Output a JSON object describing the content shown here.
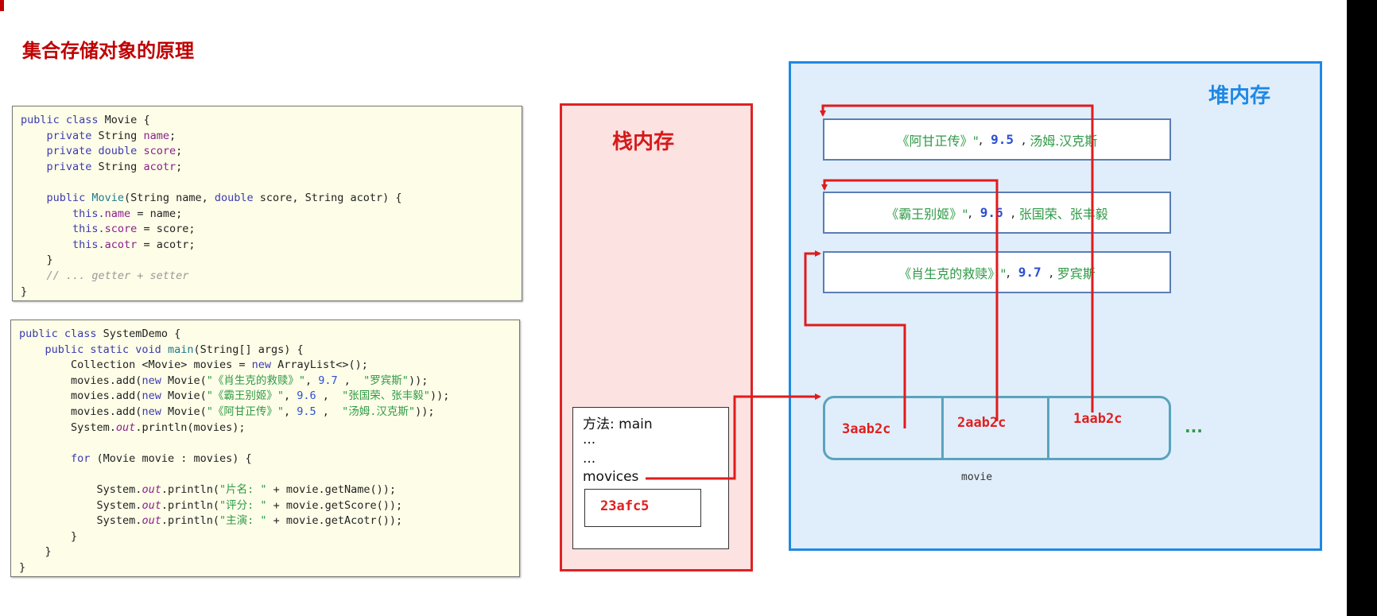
{
  "title": "集合存储对象的原理",
  "code_movie": [
    [
      [
        "public class ",
        "kw"
      ],
      [
        "Movie {",
        ""
      ]
    ],
    [
      [
        "    private ",
        "kw"
      ],
      [
        "String ",
        ""
      ],
      [
        "name",
        "fld"
      ],
      [
        ";",
        ""
      ]
    ],
    [
      [
        "    private double ",
        "kw"
      ],
      [
        "score",
        "fld"
      ],
      [
        ";",
        ""
      ]
    ],
    [
      [
        "    private ",
        "kw"
      ],
      [
        "String ",
        ""
      ],
      [
        "acotr",
        "fld"
      ],
      [
        ";",
        ""
      ]
    ],
    [
      [
        "",
        ""
      ]
    ],
    [
      [
        "    public ",
        "kw"
      ],
      [
        "Movie",
        "fn"
      ],
      [
        "(String name, ",
        ""
      ],
      [
        "double ",
        "kw"
      ],
      [
        "score, String acotr) {",
        ""
      ]
    ],
    [
      [
        "        this.",
        "kw"
      ],
      [
        "name",
        "fld"
      ],
      [
        " = name;",
        ""
      ]
    ],
    [
      [
        "        this.",
        "kw"
      ],
      [
        "score",
        "fld"
      ],
      [
        " = score;",
        ""
      ]
    ],
    [
      [
        "        this.",
        "kw"
      ],
      [
        "acotr",
        "fld"
      ],
      [
        " = acotr;",
        ""
      ]
    ],
    [
      [
        "    }",
        ""
      ]
    ],
    [
      [
        "    // ... getter + setter",
        "cm"
      ]
    ],
    [
      [
        "}",
        ""
      ]
    ]
  ],
  "code_demo": [
    [
      [
        "public class ",
        "kw"
      ],
      [
        "SystemDemo {",
        ""
      ]
    ],
    [
      [
        "    public static void ",
        "kw"
      ],
      [
        "main",
        "fn"
      ],
      [
        "(String[] args) {",
        ""
      ]
    ],
    [
      [
        "        Collection <Movie> movies = ",
        ""
      ],
      [
        "new ",
        "kw"
      ],
      [
        "ArrayList<>();",
        ""
      ]
    ],
    [
      [
        "        movies.add(",
        ""
      ],
      [
        "new ",
        "kw"
      ],
      [
        "Movie(",
        ""
      ],
      [
        "\"《肖生克的救赎》\"",
        "str"
      ],
      [
        ", ",
        ""
      ],
      [
        "9.7",
        "num"
      ],
      [
        " ,  ",
        ""
      ],
      [
        "\"罗宾斯\"",
        "str"
      ],
      [
        "));",
        ""
      ]
    ],
    [
      [
        "        movies.add(",
        ""
      ],
      [
        "new ",
        "kw"
      ],
      [
        "Movie(",
        ""
      ],
      [
        "\"《霸王别姬》\"",
        "str"
      ],
      [
        ", ",
        ""
      ],
      [
        "9.6",
        "num"
      ],
      [
        " ,  ",
        ""
      ],
      [
        "\"张国荣、张丰毅\"",
        "str"
      ],
      [
        "));",
        ""
      ]
    ],
    [
      [
        "        movies.add(",
        ""
      ],
      [
        "new ",
        "kw"
      ],
      [
        "Movie(",
        ""
      ],
      [
        "\"《阿甘正传》\"",
        "str"
      ],
      [
        ", ",
        ""
      ],
      [
        "9.5",
        "num"
      ],
      [
        " ,  ",
        ""
      ],
      [
        "\"汤姆.汉克斯\"",
        "str"
      ],
      [
        "));",
        ""
      ]
    ],
    [
      [
        "        System.",
        ""
      ],
      [
        "out",
        "it"
      ],
      [
        ".println(movies);",
        ""
      ]
    ],
    [
      [
        "",
        ""
      ]
    ],
    [
      [
        "        for ",
        "kw"
      ],
      [
        "(Movie movie : movies) {",
        ""
      ]
    ],
    [
      [
        "",
        ""
      ]
    ],
    [
      [
        "            System.",
        ""
      ],
      [
        "out",
        "it"
      ],
      [
        ".println(",
        ""
      ],
      [
        "\"片名: \"",
        "str"
      ],
      [
        " + movie.getName());",
        ""
      ]
    ],
    [
      [
        "            System.",
        ""
      ],
      [
        "out",
        "it"
      ],
      [
        ".println(",
        ""
      ],
      [
        "\"评分: \"",
        "str"
      ],
      [
        " + movie.getScore());",
        ""
      ]
    ],
    [
      [
        "            System.",
        ""
      ],
      [
        "out",
        "it"
      ],
      [
        ".println(",
        ""
      ],
      [
        "\"主演: \"",
        "str"
      ],
      [
        " + movie.getAcotr());",
        ""
      ]
    ],
    [
      [
        "        }",
        ""
      ]
    ],
    [
      [
        "    }",
        ""
      ]
    ],
    [
      [
        "}",
        ""
      ]
    ]
  ],
  "stack": {
    "label": "栈内存",
    "method": "方法: main",
    "dots1": "...",
    "dots2": "...",
    "var": "movices",
    "ref": "23afc5"
  },
  "heap": {
    "label": "堆内存",
    "objects": [
      {
        "name": "《阿甘正传》\"",
        "score": "9.5",
        "actor": "汤姆.汉克斯"
      },
      {
        "name": "《霸王别姬》\"",
        "score": "9.6",
        "actor": "张国荣、张丰毅"
      },
      {
        "name": "《肖生克的救赎》\"",
        "score": "9.7",
        "actor": "罗宾斯"
      }
    ],
    "addresses": [
      "3aab2c",
      "2aab2c",
      "1aab2c"
    ],
    "array_label": "movie",
    "more": "..."
  },
  "colors": {
    "arrow": "#e01b1b",
    "stack_border": "#dd2222",
    "heap_border": "#1e88e5",
    "title": "#c00000"
  }
}
